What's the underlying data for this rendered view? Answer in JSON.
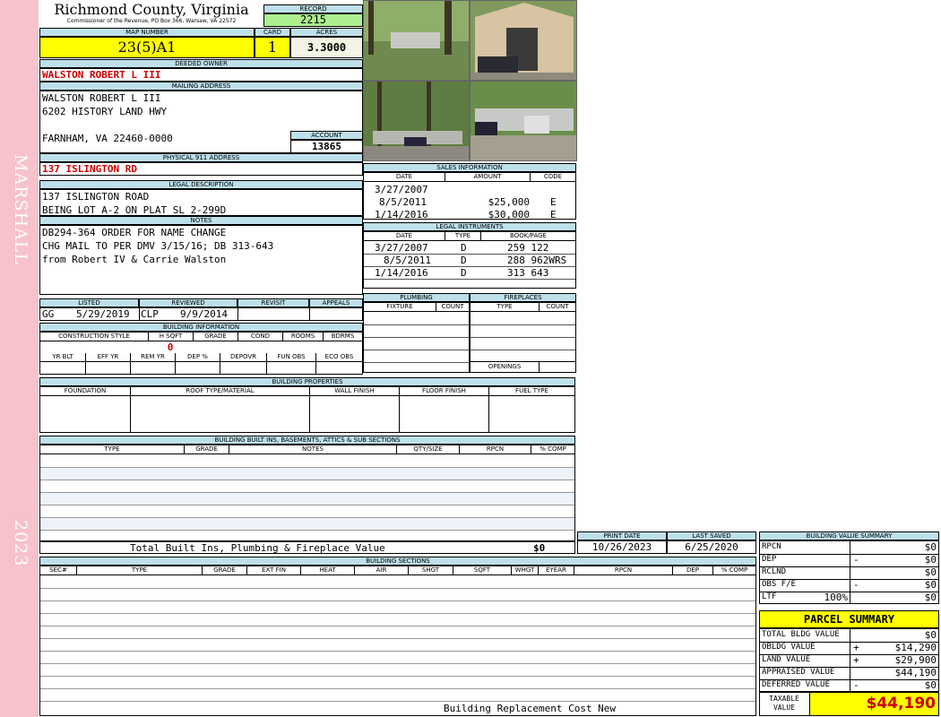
{
  "sidebar": {
    "neighborhood": "MARSHALL",
    "year": "2023"
  },
  "header": {
    "county": "Richmond County, Virginia",
    "address_line": "Commissioner of the Revenue, PO Box 366, Warsaw, VA 22572",
    "record_label": "RECORD",
    "record": "2215"
  },
  "parcel": {
    "map_number_label": "MAP NUMBER",
    "map_number": "23(5)A1",
    "card_label": "CARD",
    "card": "1",
    "acres_label": "ACRES",
    "acres": "3.3000"
  },
  "owner": {
    "deeded_label": "DEEDED OWNER",
    "deeded": "WALSTON ROBERT L III",
    "mailing_label": "MAILING ADDRESS",
    "mailing_line1": "WALSTON ROBERT L III",
    "mailing_line2": "6202 HISTORY LAND HWY",
    "mailing_line3": "FARNHAM, VA 22460-0000",
    "account_label": "ACCOUNT",
    "account": "13865",
    "physical_label": "PHYSICAL 911 ADDRESS",
    "physical": "137 ISLINGTON RD"
  },
  "legal": {
    "label": "LEGAL DESCRIPTION",
    "line1": "137 ISLINGTON ROAD",
    "line2": "BEING LOT A-2 ON PLAT SL 2-299D"
  },
  "notes": {
    "label": "NOTES",
    "line1": "DB294-364 ORDER FOR NAME CHANGE",
    "line2": "CHG MAIL TO PER DMV 3/15/16; DB 313-643",
    "line3": "from Robert IV & Carrie Walston"
  },
  "sales": {
    "label": "SALES INFORMATION",
    "headers": [
      "DATE",
      "AMOUNT",
      "CODE"
    ],
    "rows": [
      {
        "date": "3/27/2007",
        "amount": "",
        "code": ""
      },
      {
        "date": "8/5/2011",
        "amount": "$25,000",
        "code": "E"
      },
      {
        "date": "1/14/2016",
        "amount": "$30,000",
        "code": "E"
      }
    ]
  },
  "instruments": {
    "label": "LEGAL INSTRUMENTS",
    "headers": [
      "DATE",
      "TYPE",
      "BOOK/PAGE"
    ],
    "rows": [
      {
        "date": "3/27/2007",
        "type": "D",
        "book": "259 122"
      },
      {
        "date": "8/5/2011",
        "type": "D",
        "book": "288 962WRS"
      },
      {
        "date": "1/14/2016",
        "type": "D",
        "book": "313 643"
      }
    ]
  },
  "review": {
    "listed_label": "LISTED",
    "listed_by": "GG",
    "listed_date": "5/29/2019",
    "reviewed_label": "REVIEWED",
    "reviewed_by": "CLP",
    "reviewed_date": "9/9/2014",
    "revisit_label": "REVISIT",
    "appeals_label": "APPEALS"
  },
  "building_info": {
    "label": "BUILDING INFORMATION",
    "headers": [
      "CONSTRUCTION STYLE",
      "H SQFT",
      "GRADE",
      "COND",
      "ROOMS",
      "BDRMS"
    ],
    "hsqft": "0",
    "headers2": [
      "YR BLT",
      "EFF YR",
      "REM YR",
      "DEP %",
      "DEPOVR",
      "FUN OBS",
      "ECO OBS"
    ]
  },
  "plumbing": {
    "label": "PLUMBING",
    "headers": [
      "FIXTURE",
      "COUNT"
    ]
  },
  "fireplaces": {
    "label": "FIREPLACES",
    "headers": [
      "TYPE",
      "COUNT"
    ],
    "openings": "OPENINGS"
  },
  "properties": {
    "label": "BUILDING PROPERTIES",
    "headers": [
      "FOUNDATION",
      "ROOF TYPE/MATERIAL",
      "WALL FINISH",
      "FLOOR FINISH",
      "FUEL TYPE"
    ]
  },
  "builtins": {
    "label": "BUILDING BUILT INS, BASEMENTS, ATTICS & SUB SECTIONS",
    "headers": [
      "TYPE",
      "GRADE",
      "NOTES",
      "QTY/SIZE",
      "RPCN",
      "% COMP"
    ],
    "total_label": "Total Built Ins, Plumbing & Fireplace Value",
    "total_value": "$0"
  },
  "dates": {
    "print_label": "PRINT DATE",
    "print_date": "10/26/2023",
    "saved_label": "LAST SAVED",
    "saved_date": "6/25/2020"
  },
  "sections": {
    "label": "BUILDING SECTIONS",
    "headers": [
      "SEC#",
      "TYPE",
      "GRADE",
      "EXT FIN",
      "HEAT",
      "AIR",
      "SHGT",
      "SQFT",
      "WHGT",
      "EYEAR",
      "RPCN",
      "DEP",
      "% COMP"
    ],
    "footer": "Building Replacement Cost New"
  },
  "value_summary": {
    "label": "BUILDING VALUE SUMMARY",
    "rows": [
      {
        "label": "RPCN",
        "sign": "",
        "value": "$0"
      },
      {
        "label": "DEP",
        "sign": "-",
        "value": "$0"
      },
      {
        "label": "RCLND",
        "sign": "",
        "value": "$0"
      },
      {
        "label": "OBS F/E",
        "sign": "-",
        "value": "$0"
      },
      {
        "label": "LTF",
        "sign": "100%",
        "value": "$0"
      }
    ]
  },
  "parcel_summary": {
    "label": "PARCEL SUMMARY",
    "rows": [
      {
        "label": "TOTAL BLDG VALUE",
        "sign": "",
        "value": "$0"
      },
      {
        "label": "OBLDG VALUE",
        "sign": "+",
        "value": "$14,290"
      },
      {
        "label": "LAND VALUE",
        "sign": "+",
        "value": "$29,900"
      },
      {
        "label": "APPRAISED VALUE",
        "sign": "",
        "value": "$44,190"
      },
      {
        "label": "DEFERRED VALUE",
        "sign": "-",
        "value": "$0"
      }
    ],
    "taxable_label1": "TAXABLE",
    "taxable_label2": "VALUE",
    "taxable_value": "$44,190"
  },
  "colors": {
    "header_blue": "#bde0ea",
    "yellow": "#ffff00",
    "green": "#aef08f",
    "sidebar_pink": "#f7c2cb",
    "red": "#cc0000"
  }
}
